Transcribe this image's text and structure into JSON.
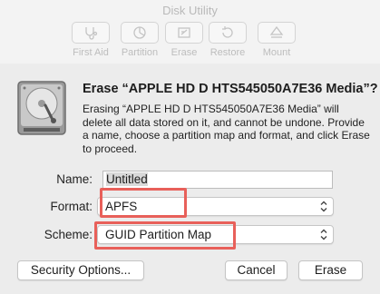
{
  "window": {
    "title": "Disk Utility"
  },
  "toolbar": {
    "items": [
      {
        "label": "First Aid",
        "icon": "stethoscope-icon"
      },
      {
        "label": "Partition",
        "icon": "pie-chart-icon"
      },
      {
        "label": "Erase",
        "icon": "erase-icon"
      },
      {
        "label": "Restore",
        "icon": "restore-icon"
      },
      {
        "label": "Mount",
        "icon": "eject-icon"
      }
    ]
  },
  "sheet": {
    "title": "Erase “APPLE HD D HTS545050A7E36 Media”?",
    "description": "Erasing “APPLE HD D HTS545050A7E36 Media” will delete all data stored on it, and cannot be undone. Provide a name, choose a partition map and format, and click Erase to proceed.",
    "name_label": "Name:",
    "name_value": "Untitled",
    "format_label": "Format:",
    "format_value": "APFS",
    "scheme_label": "Scheme:",
    "scheme_value": "GUID Partition Map"
  },
  "buttons": {
    "security_options": "Security Options...",
    "cancel": "Cancel",
    "erase": "Erase"
  },
  "colors": {
    "highlight": "#e8605a",
    "background": "#ececec"
  }
}
